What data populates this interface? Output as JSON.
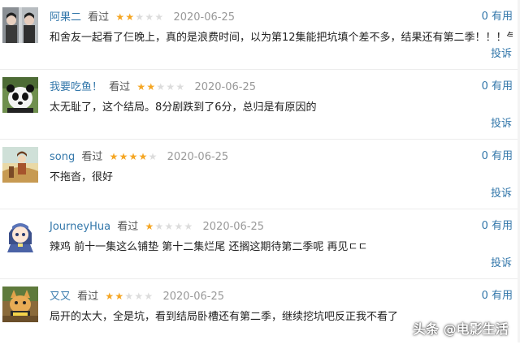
{
  "reviews": [
    {
      "user": "阿果二",
      "watched": "看过",
      "rating": 2,
      "date": "2020-06-25",
      "votes_count": "0",
      "votes_label": "有用",
      "content": "和舍友一起看了仨晚上，真的是浪费时间，以为第12集能把坑填个差不多，结果还有第二季！！！气死了",
      "report": "投诉"
    },
    {
      "user": "我要吃鱼！",
      "watched": "看过",
      "rating": 2,
      "date": "2020-06-25",
      "votes_count": "0",
      "votes_label": "有用",
      "content": "太无耻了，这个结局。8分剧跌到了6分，总归是有原因的",
      "report": "投诉"
    },
    {
      "user": "song",
      "watched": "看过",
      "rating": 4,
      "date": "2020-06-25",
      "votes_count": "0",
      "votes_label": "有用",
      "content": "不拖沓，很好",
      "report": "投诉"
    },
    {
      "user": "JourneyHua",
      "watched": "看过",
      "rating": 1,
      "date": "2020-06-25",
      "votes_count": "0",
      "votes_label": "有用",
      "content": "辣鸡 前十一集这么铺垫 第十二集烂尾 还搁这期待第二季呢 再见ㄷㄷ",
      "report": "投诉"
    },
    {
      "user": "又又",
      "watched": "看过",
      "rating": 2,
      "date": "2020-06-25",
      "votes_count": "0",
      "votes_label": "有用",
      "content": "局开的太大，全是坑，看到结局卧槽还有第二季，继续挖坑吧反正我不看了",
      "report": "投诉"
    }
  ],
  "watermark": "头条 @电影生活",
  "colors": {
    "link": "#3377aa",
    "star": "#f5a623",
    "star_off": "#dcdcdc",
    "date": "#999999"
  },
  "avatar_icons": [
    "user-photo-avatar",
    "panda-avatar",
    "anime-art-avatar",
    "anime-girl-avatar",
    "cat-judge-avatar"
  ]
}
